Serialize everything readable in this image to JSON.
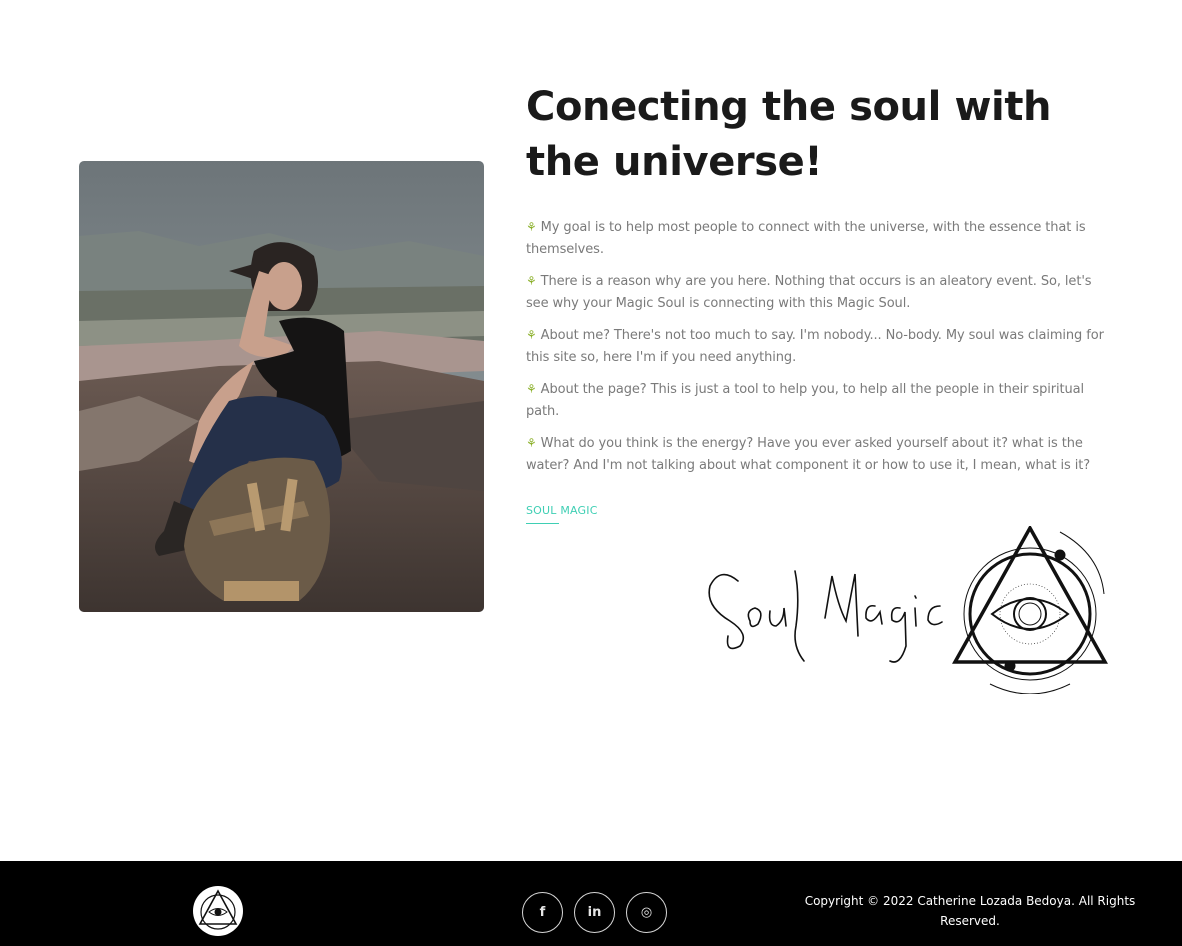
{
  "hero": {
    "photo_alt": "Woman sitting on a rock with a backpack",
    "headline": "Conecting the soul with the universe!",
    "paragraphs": [
      "My goal is to help most people to connect with the universe, with the essence that is themselves.",
      "There is a reason why are you here. Nothing that occurs is an aleatory event. So, let's see why your Magic Soul is connecting with this Magic Soul.",
      "About me? There's not too much to say. I'm nobody... No-body. My soul was claiming for this site so, here I'm if you need anything.",
      "About the page? This is just a tool to help you, to help all the people in their spiritual path.",
      "What do you think is the energy? Have you ever asked yourself about it? what is the water? And I'm not talking about what component it or how to use it, I mean, what is it?"
    ],
    "bullet_icon": "sprout-icon",
    "bullet_glyph": "⚘",
    "link_label": "SOUL MAGIC",
    "signature_text": "Soul Magic",
    "logo_icon": "eye-triangle-icon"
  },
  "footer": {
    "logo_icon": "eye-triangle-icon",
    "socials": [
      {
        "name": "facebook-icon",
        "glyph": "f"
      },
      {
        "name": "linkedin-icon",
        "glyph": "in"
      },
      {
        "name": "instagram-icon",
        "glyph": "◎"
      }
    ],
    "copyright": "Copyright © 2022 Catherine Lozada Bedoya. All Rights Reserved."
  },
  "colors": {
    "accent": "#3fcfb4",
    "bullet": "#8bb02a",
    "footer_bg": "#000000",
    "body_text": "#7a7a7a",
    "heading": "#1a1a1a"
  }
}
